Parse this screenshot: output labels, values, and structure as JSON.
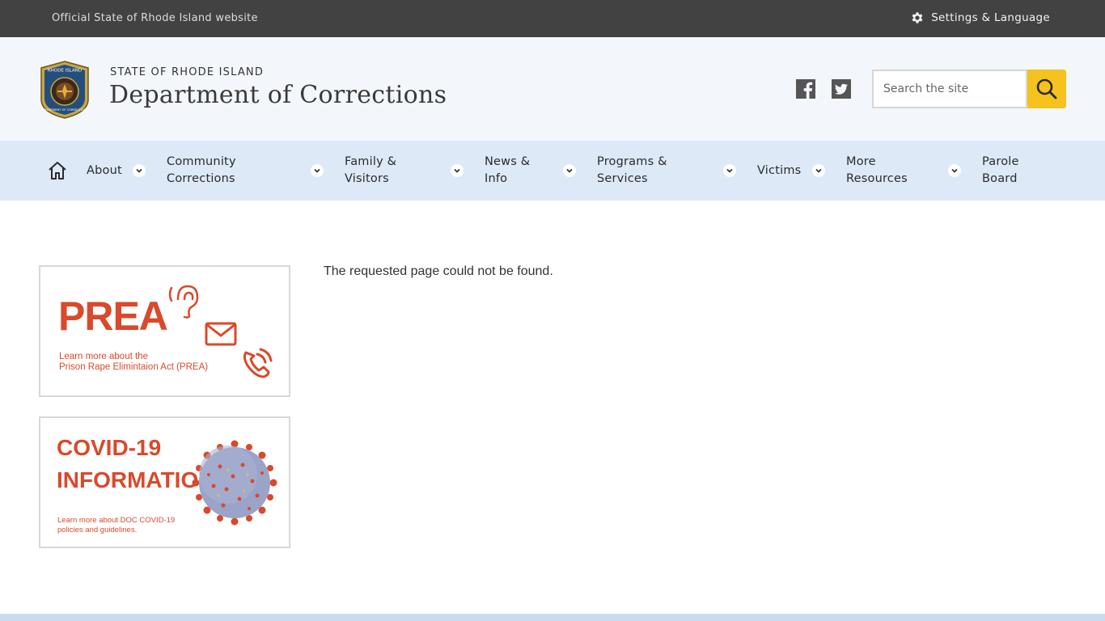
{
  "topbar": {
    "official_text": "Official State of Rhode Island website",
    "settings_label": "Settings & Language"
  },
  "header": {
    "state_name": "STATE OF RHODE ISLAND",
    "department": "Department of Corrections",
    "seal_text_top": "RHODE ISLAND",
    "seal_text_bottom": "DEPARTMENT OF CORRECTIONS",
    "social": [
      "facebook-icon",
      "twitter-icon"
    ],
    "search": {
      "placeholder": "Search the site",
      "button_icon": "search-icon"
    }
  },
  "nav": {
    "home_icon": "home-icon",
    "items": [
      {
        "line1": "About",
        "line2": "",
        "dropdown": true
      },
      {
        "line1": "Community",
        "line2": "Corrections",
        "dropdown": true
      },
      {
        "line1": "Family &",
        "line2": "Visitors",
        "dropdown": true
      },
      {
        "line1": "News &",
        "line2": "Info",
        "dropdown": true
      },
      {
        "line1": "Programs &",
        "line2": "Services",
        "dropdown": true
      },
      {
        "line1": "Victims",
        "line2": "",
        "dropdown": true
      },
      {
        "line1": "More",
        "line2": "Resources",
        "dropdown": true
      },
      {
        "line1": "Parole",
        "line2": "Board",
        "dropdown": false
      }
    ]
  },
  "cards": {
    "prea": {
      "title": "PREA",
      "line1": "Learn more about the",
      "line2": "Prison Rape Elimintaion Act (PREA)"
    },
    "covid": {
      "title1": "COVID-19",
      "title2": "INFORMATION",
      "line1": "Learn more about DOC COVID-19",
      "line2": "policies and guidelines."
    }
  },
  "main": {
    "message": "The requested page could not be found."
  },
  "colors": {
    "topbar": "#424242",
    "header_bg": "#f3f6fb",
    "nav_bg": "#dde9f7",
    "search_button": "#f5c21e",
    "card_red": "#d9492b"
  }
}
